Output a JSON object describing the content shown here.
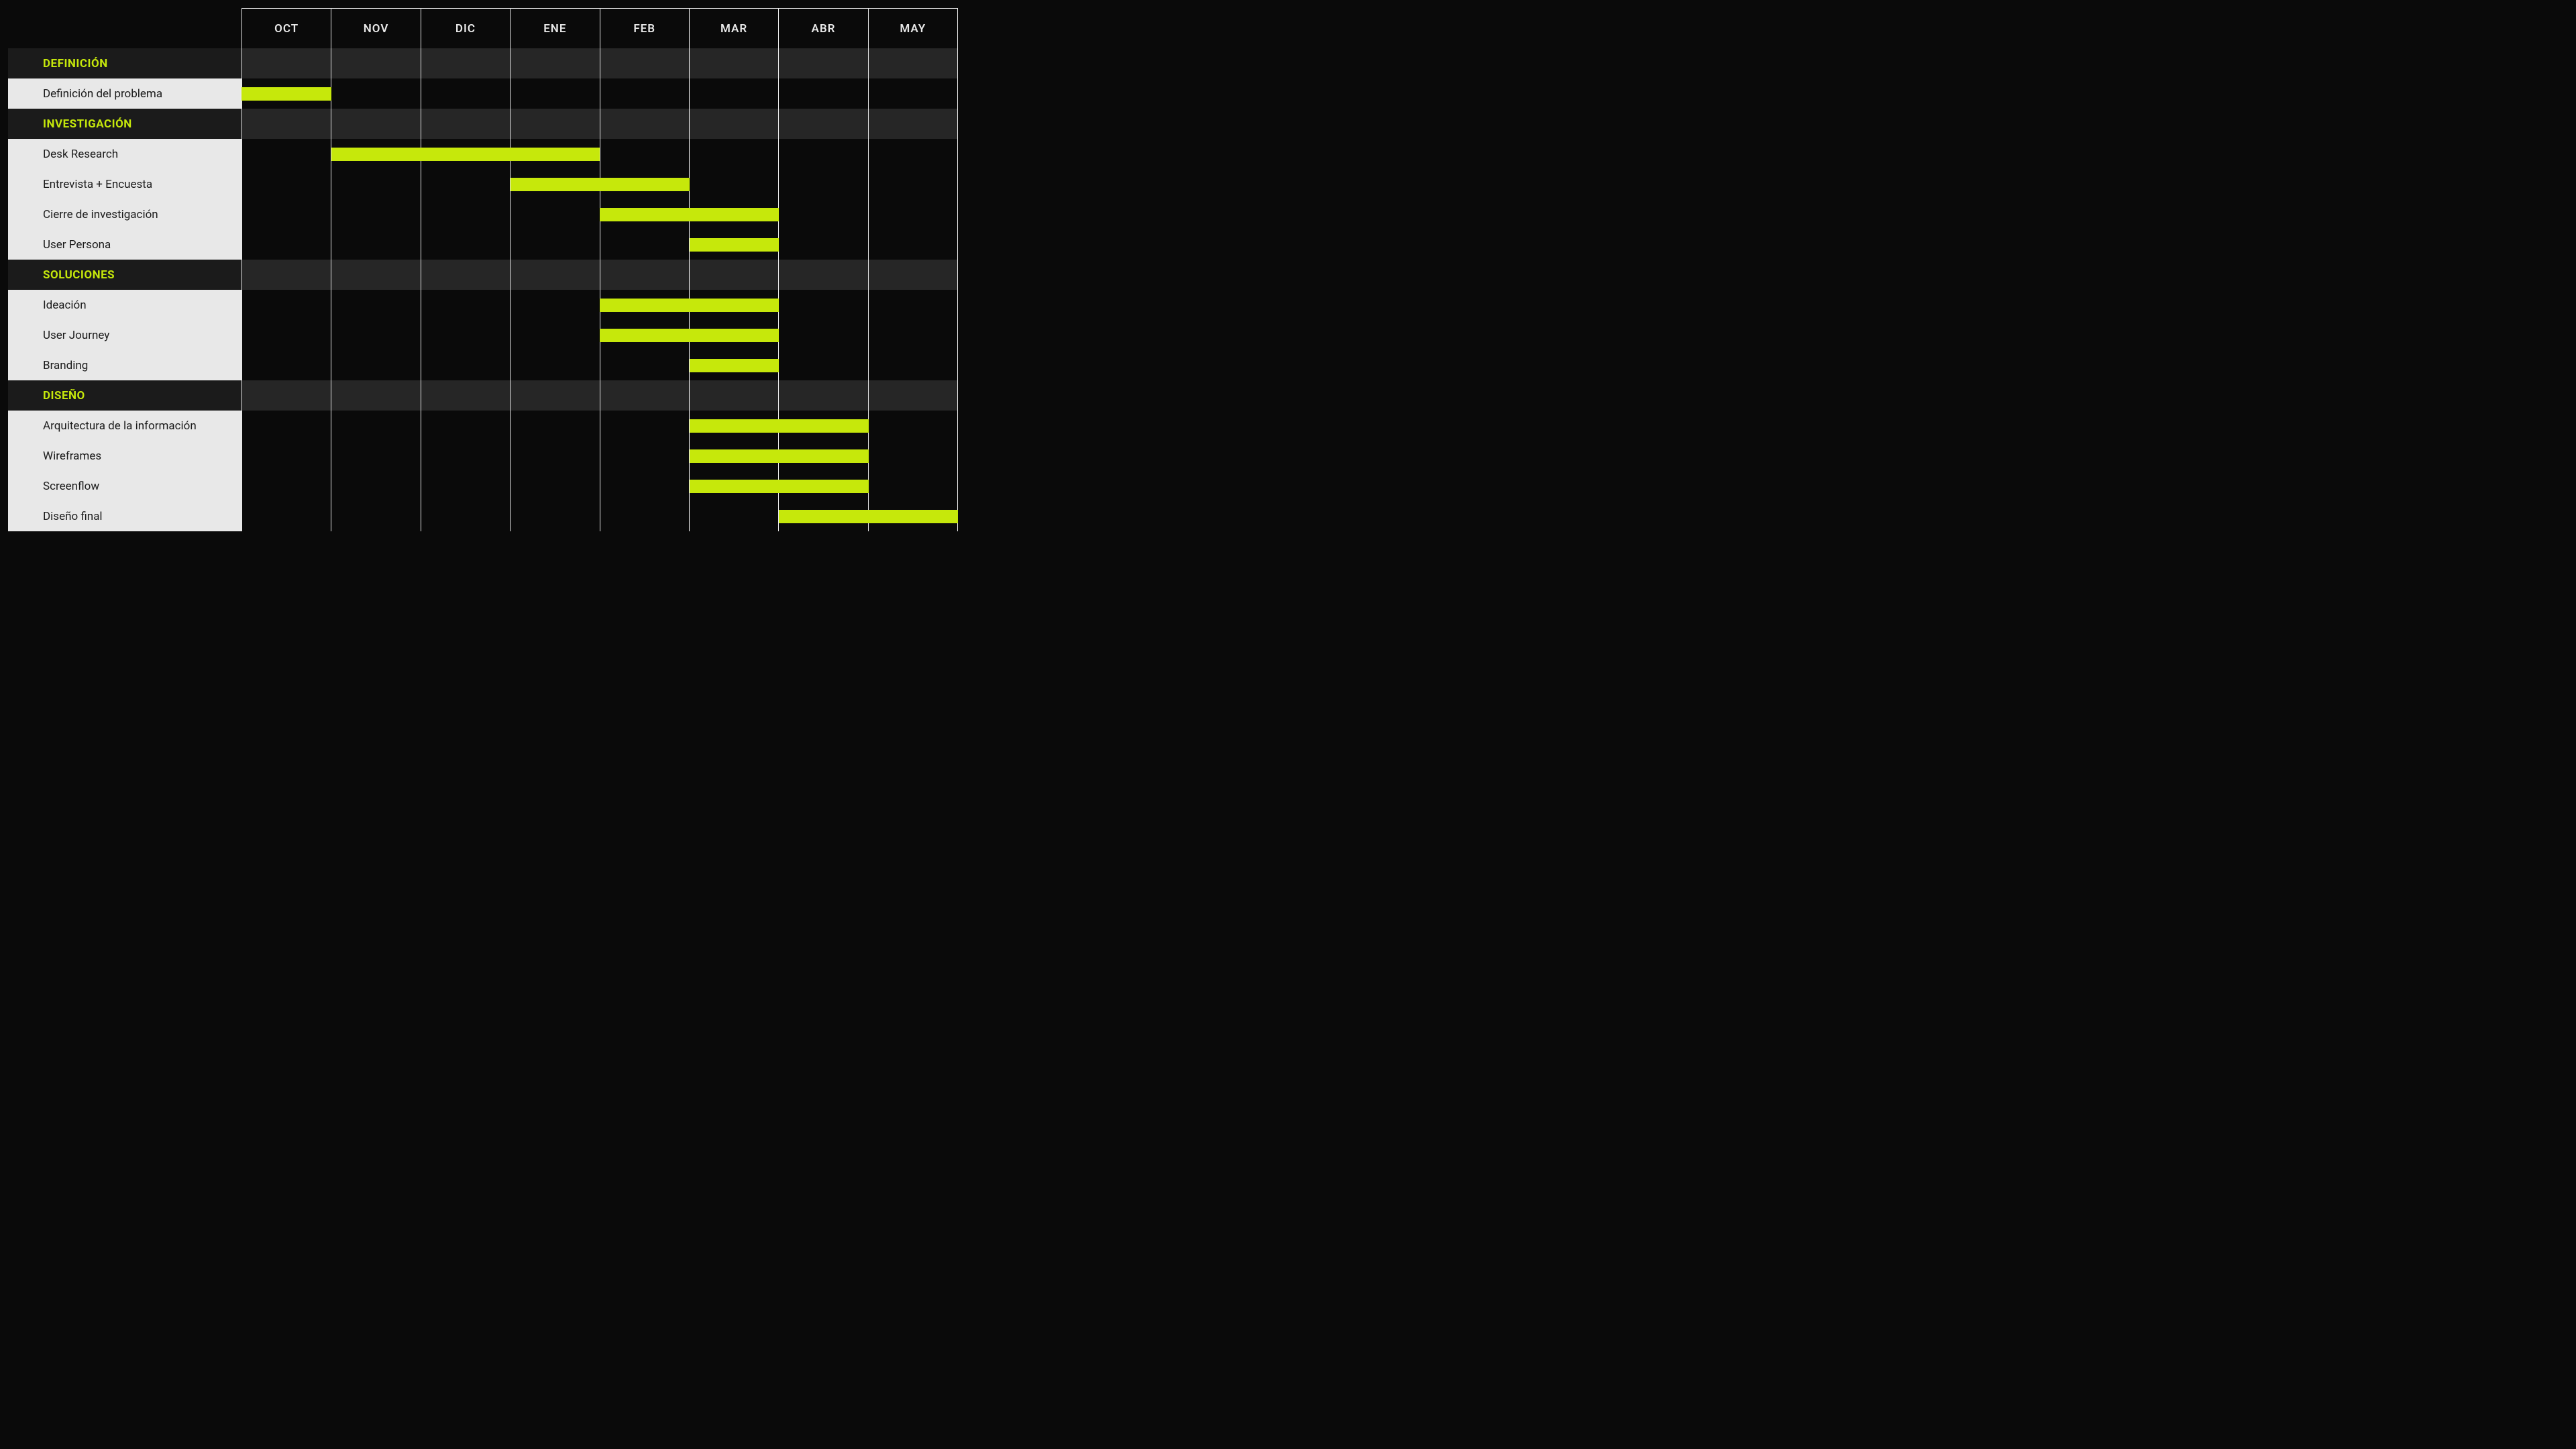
{
  "chart_data": {
    "type": "gantt",
    "title": "",
    "x_axis": {
      "type": "months",
      "range": [
        "OCT",
        "MAY"
      ],
      "columns": 8
    },
    "months": [
      "OCT",
      "NOV",
      "DIC",
      "ENE",
      "FEB",
      "MAR",
      "ABR",
      "MAY"
    ],
    "sections": [
      {
        "name": "DEFINICIÓN",
        "tasks": [
          {
            "name": "Definición del problema",
            "start": 0.0,
            "end": 1.0
          }
        ]
      },
      {
        "name": "INVESTIGACIÓN",
        "tasks": [
          {
            "name": "Desk Research",
            "start": 1.0,
            "end": 4.0
          },
          {
            "name": "Entrevista + Encuesta",
            "start": 3.0,
            "end": 5.0
          },
          {
            "name": "Cierre de investigación",
            "start": 4.0,
            "end": 6.0
          },
          {
            "name": "User Persona",
            "start": 5.0,
            "end": 6.0
          }
        ]
      },
      {
        "name": "SOLUCIONES",
        "tasks": [
          {
            "name": "Ideación",
            "start": 4.0,
            "end": 6.0
          },
          {
            "name": "User Journey",
            "start": 4.0,
            "end": 6.0
          },
          {
            "name": "Branding",
            "start": 5.0,
            "end": 6.0
          }
        ]
      },
      {
        "name": "DISEÑO",
        "tasks": [
          {
            "name": "Arquitectura de la información",
            "start": 5.0,
            "end": 7.0
          },
          {
            "name": "Wireframes",
            "start": 5.0,
            "end": 7.0
          },
          {
            "name": "Screenflow",
            "start": 5.0,
            "end": 7.0
          },
          {
            "name": "Diseño final",
            "start": 6.0,
            "end": 8.0
          }
        ]
      }
    ],
    "colors": {
      "bar": "#c6e80b",
      "section_label": "#c6e80b",
      "task_label_bg": "#e8e8e8",
      "section_label_bg": "#1b1b1b",
      "section_timeline_bg": "#262626",
      "grid": "#e8e8e8",
      "background": "#0a0a0a"
    }
  }
}
